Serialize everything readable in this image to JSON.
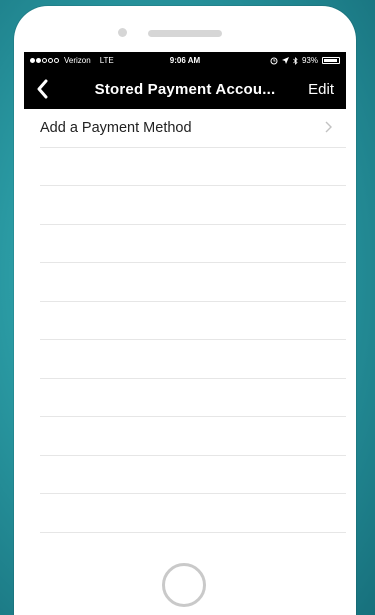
{
  "status_bar": {
    "carrier": "Verizon",
    "network": "LTE",
    "time": "9:06 AM",
    "battery": "93%"
  },
  "nav": {
    "title": "Stored Payment Accou...",
    "edit_label": "Edit"
  },
  "list": {
    "items": [
      {
        "label": "Add a Payment Method"
      }
    ]
  }
}
